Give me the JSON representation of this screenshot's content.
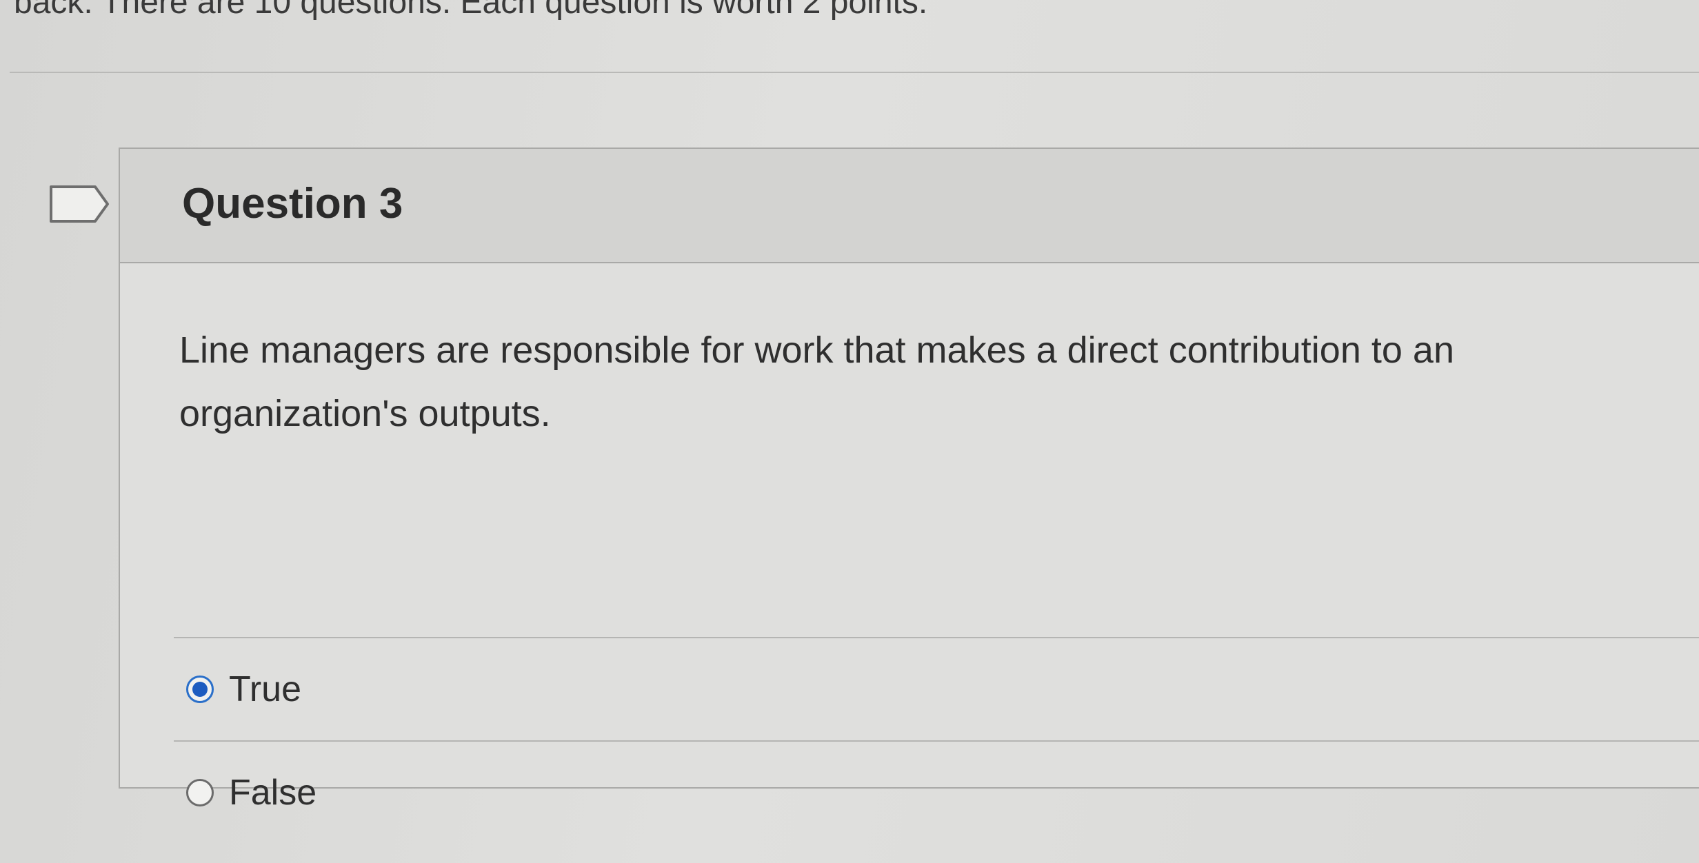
{
  "intro": {
    "text": "back.  There are 10 questions.  Each question is worth 2 points."
  },
  "question": {
    "title": "Question 3",
    "text": "Line managers are responsible for work that makes a direct contribution to an organization's outputs.",
    "flag_icon": "flag-icon",
    "answers": [
      {
        "label": "True",
        "selected": true
      },
      {
        "label": "False",
        "selected": false
      }
    ]
  },
  "colors": {
    "radio_selected": "#1d5cc0",
    "background": "#dcdcdb"
  }
}
